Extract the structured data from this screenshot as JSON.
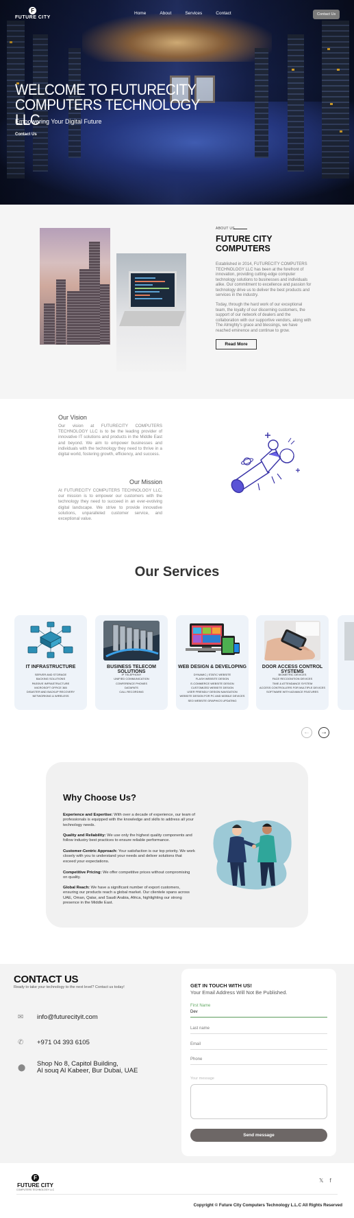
{
  "nav": {
    "logo_text": "FUTURE CITY",
    "logo_mark": "F",
    "links": [
      "Home",
      "About",
      "Services",
      "Contact"
    ],
    "cta": "Contact Us"
  },
  "hero": {
    "title_line1": "WELCOME TO FUTURECITY",
    "title_line2": "COMPUTERS TECHNOLOGY LLC",
    "subtitle": "Empowering Your Digital Future",
    "cta": "Contact Us"
  },
  "about": {
    "label": "ABOUT US",
    "title_line1": "FUTURE CITY",
    "title_line2": "COMPUTERS",
    "p1": "Established in 2014, FUTURECITY COMPUTERS TECHNOLOGY LLC has been at the forefront of innovation, providing cutting-edge computer technology solutions to businesses and individuals alike. Our commitment to excellence and passion for technology drive us to deliver the best products and services in the industry.",
    "p2": "Today, through the hard work of our exceptional team, the loyalty of our discerning customers, the support of our network of dealers and the collaboration with our supportive vendors, along with The Almighty's grace and blessings, we have reached eminence and continue to grow.",
    "button": "Read More"
  },
  "vision": {
    "title": "Our Vision",
    "text": "Our vision at FUTURECITY COMPUTERS TECHNOLOGY LLC is to be the leading provider of innovative IT solutions and products in the Middle East and beyond. We aim to empower businesses and individuals with the technology they need to thrive in a digital world, fostering growth, efficiency, and success."
  },
  "mission": {
    "title": "Our Mission",
    "text": "At FUTURECITY COMPUTERS TECHNOLOGY LLC, our mission is to empower our customers with the technology they need to succeed in an ever-evolving digital landscape. We strive to provide innovative solutions, unparalleled customer service, and exceptional value."
  },
  "services": {
    "title": "Our Services",
    "cards": [
      {
        "title": "IT INFRASTRUCTURE",
        "items": [
          "SERVER AND STORAGE",
          "BACKING SOLUTIONS",
          "PASSIVE INFRASTRUCTURE",
          "MICROSOFT OFFICE 365",
          "DISASTER AND BACKUP RECOVERY",
          "NETWORKING & WIRELESS"
        ]
      },
      {
        "title": "BUSINESS TELECOM SOLUTIONS",
        "items": [
          "IP TELEPHONY",
          "UNIFIED COMMUNICATION",
          "CONFERENCE PHONES",
          "DATAPATS",
          "CALL RECORDING"
        ]
      },
      {
        "title": "WEB DESIGN & DEVELOPING",
        "items": [
          "DYNAMIC | STATIC WEBSITE",
          "FLASH WEBSITE DESIGN",
          "E-COMMERCE WEBSITE DESIGN",
          "CUSTOMIZED WEBSITE DESIGN",
          "USER FRIENDLY DESIGN NAVIGATION",
          "WEBSITE DESIGN FOR PC AND MOBILE DEVICES",
          "SEO WEBSITE GRAPHICS UPDATING"
        ]
      },
      {
        "title": "DOOR ACCESS CONTROL SYSTEMS",
        "items": [
          "BIOMETRIC DEVICES",
          "FACE RECOGNITION DEVICES",
          "TIME & ATTENDANCE SYSTEM",
          "ACCESS CONTROLLERS FOR MULTIPLE DEVICES",
          "SOFTWARE WITH ADVANCE FEATURES"
        ]
      }
    ],
    "prev_arrow": "←",
    "next_arrow": "→"
  },
  "why": {
    "title": "Why Choose Us?",
    "points": [
      {
        "label": "Experience and Expertise:",
        "text": " With over a decade of experience, our team of professionals is equipped with the knowledge and skills to address all your technology needs."
      },
      {
        "label": "Quality and Reliability:",
        "text": " We use only the highest quality components and follow industry best practices to ensure reliable performance."
      },
      {
        "label": "Customer-Centric Approach:",
        "text": " Your satisfaction is our top priority. We work closely with you to understand your needs and deliver solutions that exceed your expectations."
      },
      {
        "label": "Competitive Pricing:",
        "text": " We offer competitive prices without compromising on quality."
      },
      {
        "label": "Global Reach:",
        "text": " We have a significant number of export customers, ensuring our products reach a global market. Our clientele spans across UAE, Oman, Qatar, and Saudi Arabia, Africa, highlighting our strong presence in the Middle East."
      }
    ]
  },
  "contact": {
    "title": "CONTACT US",
    "tagline": "Ready to take your technology to the next level? Contact us today!",
    "email": "info@futurecityit.com",
    "phone": "+971 04 393 6105",
    "address_line1": "Shop No 8, Capitol Building,",
    "address_line2": "Al souq Al Kabeer, Bur Dubai, UAE",
    "form": {
      "heading1": "GET IN TOUCH WITH US!",
      "heading2": "Your Email Address Will Not Be Published.",
      "first_name_label": "First Name",
      "first_name_value": "Dev",
      "last_name_placeholder": "Last name",
      "email_placeholder": "Email",
      "phone_placeholder": "Phone",
      "message_label": "Your message",
      "send": "Send message"
    }
  },
  "footer": {
    "logo_text": "FUTURE CITY",
    "logo_mark": "F",
    "logo_tagline": "COMPUTERS TECHNOLOGY LLC",
    "copyright": "Copyright © Future City Computers Technology L.L.C All Rights Reserved",
    "social_x": "𝕏",
    "social_fb": "f"
  }
}
